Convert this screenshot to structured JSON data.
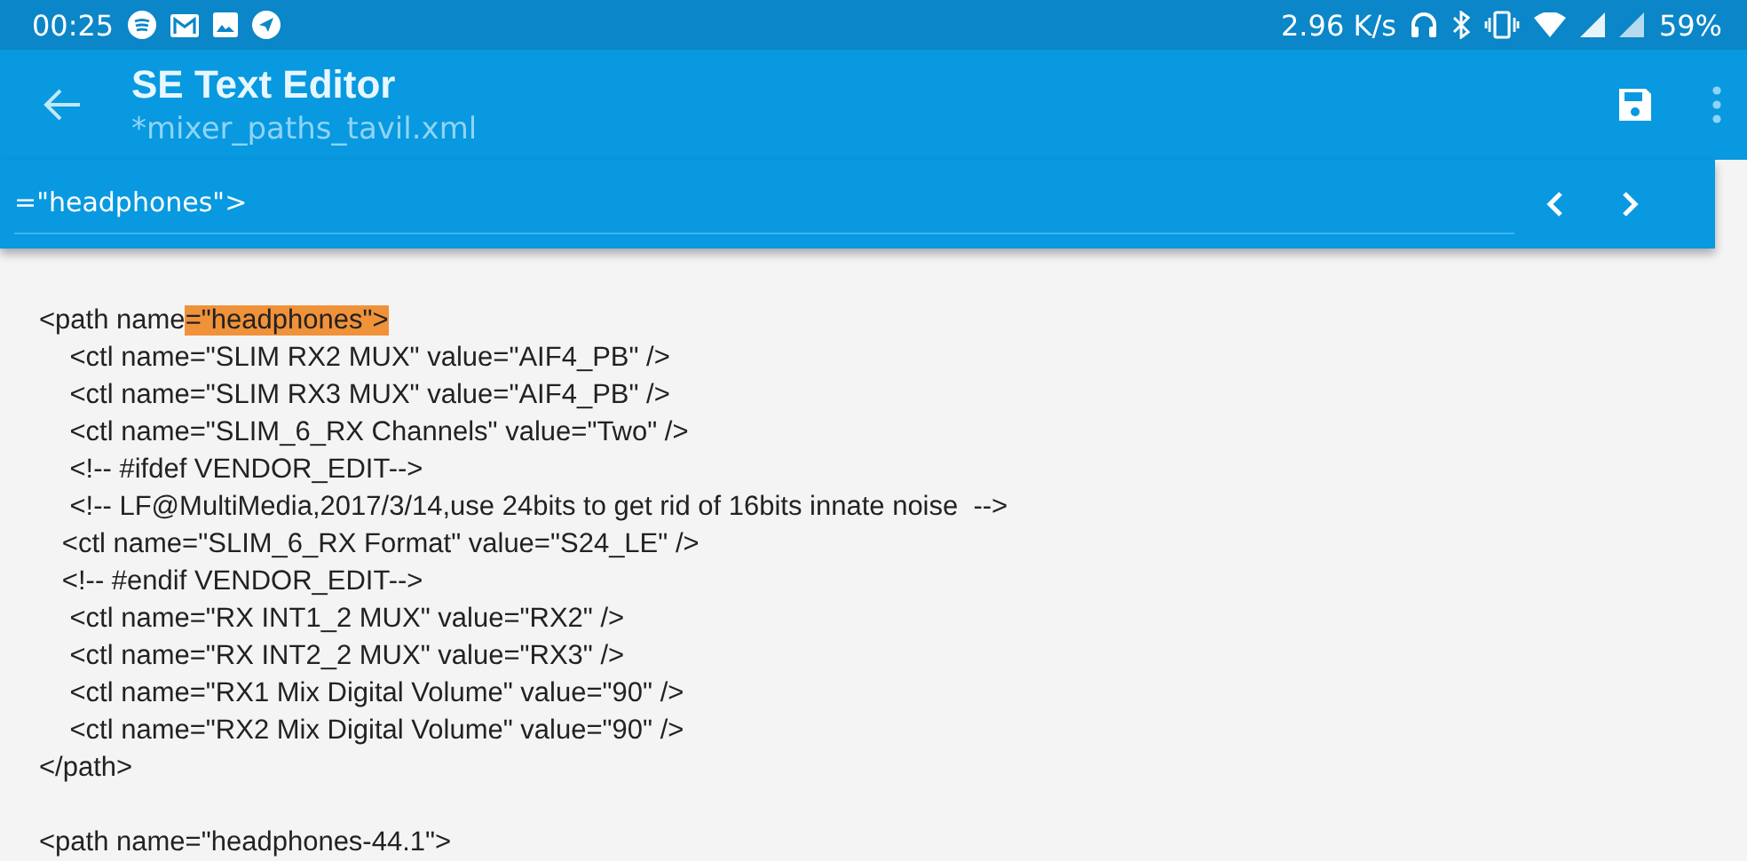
{
  "status_bar": {
    "time": "00:25",
    "speed": "2.96 K/s",
    "battery": "59%"
  },
  "app_bar": {
    "title": "SE Text Editor",
    "subtitle": "*mixer_paths_tavil.xml"
  },
  "search": {
    "value": "=\"headphones\">"
  },
  "code_lines": [
    {
      "text": "<path name",
      "match": "=\"headphones\">"
    },
    {
      "text": "    <ctl name=\"SLIM RX2 MUX\" value=\"AIF4_PB\" />"
    },
    {
      "text": "    <ctl name=\"SLIM RX3 MUX\" value=\"AIF4_PB\" />"
    },
    {
      "text": "    <ctl name=\"SLIM_6_RX Channels\" value=\"Two\" />"
    },
    {
      "text": "    <!-- #ifdef VENDOR_EDIT-->"
    },
    {
      "text": "    <!-- LF@MultiMedia,2017/3/14,use 24bits to get rid of 16bits innate noise  -->"
    },
    {
      "text": "   <ctl name=\"SLIM_6_RX Format\" value=\"S24_LE\" />"
    },
    {
      "text": "   <!-- #endif VENDOR_EDIT-->"
    },
    {
      "text": "    <ctl name=\"RX INT1_2 MUX\" value=\"RX2\" />"
    },
    {
      "text": "    <ctl name=\"RX INT2_2 MUX\" value=\"RX3\" />"
    },
    {
      "text": "    <ctl name=\"RX1 Mix Digital Volume\" value=\"90\" />"
    },
    {
      "text": "    <ctl name=\"RX2 Mix Digital Volume\" value=\"90\" />"
    },
    {
      "text": "</path>"
    },
    {
      "text": "<path name=\"headphones-44.1\">",
      "blank_before": true
    }
  ]
}
